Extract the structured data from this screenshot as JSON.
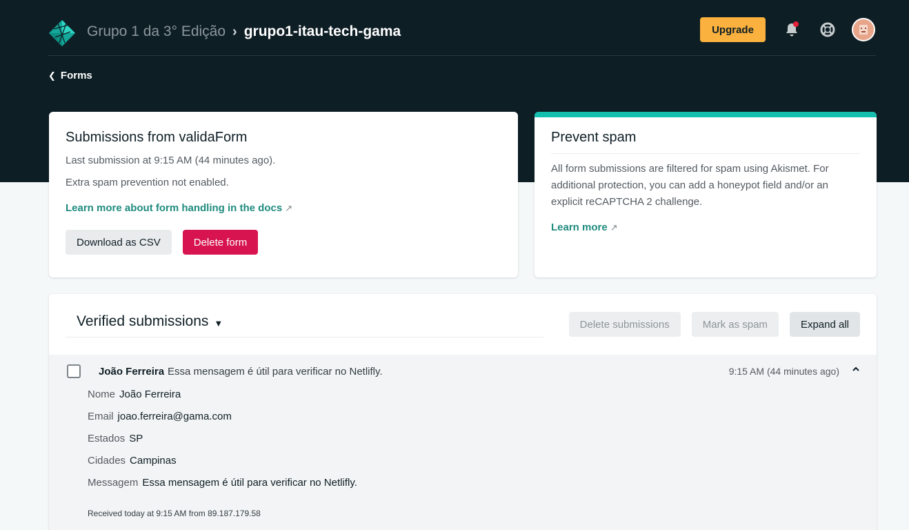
{
  "header": {
    "team_name": "Grupo 1 da 3° Edição",
    "separator": "›",
    "site_name": "grupo1-itau-tech-gama",
    "upgrade_label": "Upgrade",
    "icons": [
      "netlify-logo-icon",
      "bell-icon",
      "help-lifebuoy-icon",
      "avatar"
    ]
  },
  "back": {
    "label": "Forms"
  },
  "form_card": {
    "title": "Submissions from validaForm",
    "last_submission": "Last submission at 9:15 AM (44 minutes ago).",
    "spam_note": "Extra spam prevention not enabled.",
    "docs_link": "Learn more about form handling in the docs",
    "ext_glyph": "↗",
    "download_label": "Download as CSV",
    "delete_label": "Delete form"
  },
  "spam_card": {
    "title": "Prevent spam",
    "body": "All form submissions are filtered for spam using Akismet. For additional protection, you can add a honeypot field and/or an explicit reCAPTCHA 2 challenge.",
    "learn_more": "Learn more",
    "ext_glyph": "↗"
  },
  "submissions": {
    "title": "Verified submissions",
    "delete_label": "Delete submissions",
    "spam_label": "Mark as spam",
    "expand_label": "Expand all",
    "item": {
      "name": "João Ferreira",
      "preview": "Essa mensagem é útil para verificar no Netlifly.",
      "time": "9:15 AM (44 minutes ago)",
      "fields": [
        {
          "label": "Nome",
          "value": "João Ferreira"
        },
        {
          "label": "Email",
          "value": "joao.ferreira@gama.com"
        },
        {
          "label": "Estados",
          "value": "SP"
        },
        {
          "label": "Cidades",
          "value": "Campinas"
        },
        {
          "label": "Messagem",
          "value": "Essa mensagem é útil para verificar no Netlifly."
        }
      ],
      "received": "Received today at 9:15 AM from 89.187.179.58"
    }
  },
  "colors": {
    "dark_bg": "#0e1e25",
    "accent_teal": "#15bfae",
    "link_teal": "#1f8b7e",
    "upgrade_yellow": "#fbb13d",
    "danger": "#d7144f"
  }
}
